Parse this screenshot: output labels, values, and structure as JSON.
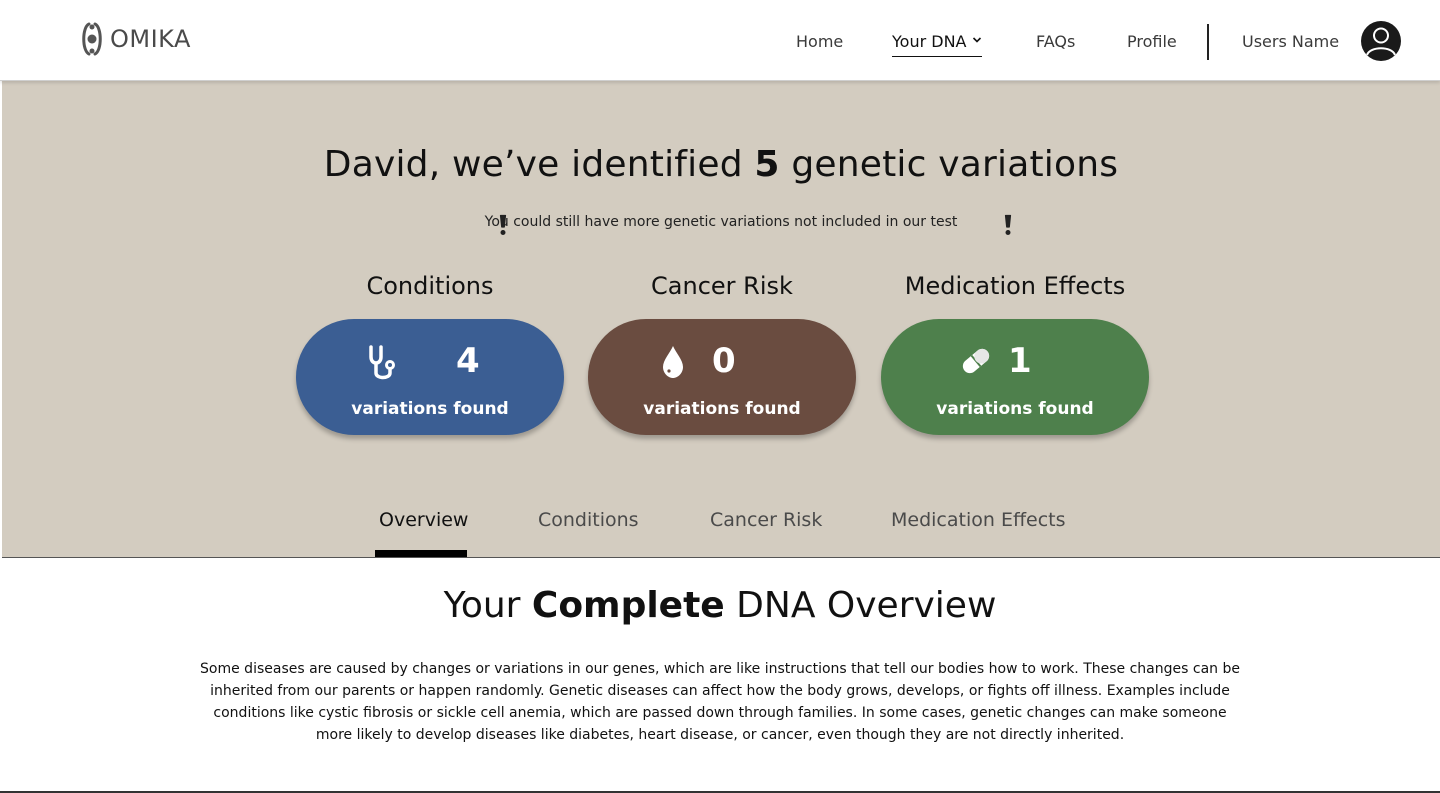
{
  "brand": {
    "name": "OMIKA"
  },
  "nav": {
    "home": "Home",
    "your_dna": "Your DNA",
    "faqs": "FAQs",
    "profile": "Profile",
    "user_name": "Users Name"
  },
  "hero": {
    "headline_prefix": "David, we’ve identified ",
    "headline_count": "5",
    "headline_suffix": " genetic variations",
    "notice": "You could still have more genetic variations not included in our test",
    "cards": [
      {
        "title": "Conditions",
        "count": "4",
        "label": "variations found",
        "icon": "stethoscope-icon",
        "color": "#3b5e93"
      },
      {
        "title": "Cancer Risk",
        "count": "0",
        "label": "variations found",
        "icon": "drop-icon",
        "color": "#6a4c40"
      },
      {
        "title": "Medication Effects",
        "count": "1",
        "label": "variations found",
        "icon": "pill-icon",
        "color": "#4e804c"
      }
    ]
  },
  "tabs": {
    "overview": "Overview",
    "conditions": "Conditions",
    "cancer_risk": "Cancer Risk",
    "medication_effects": "Medication Effects",
    "active": "Overview"
  },
  "overview": {
    "title_prefix": "Your ",
    "title_bold": "Complete",
    "title_suffix": " DNA Overview",
    "body": "Some diseases are caused by changes or variations in our genes, which are like instructions that tell our bodies how to work. These changes can be inherited from our parents or happen randomly. Genetic diseases can affect how the body grows, develops, or fights off illness. Examples include conditions like cystic fibrosis or sickle cell anemia, which are passed down through families. In some cases, genetic changes can make someone more likely to develop diseases like diabetes, heart disease, or cancer, even though they are not directly inherited."
  },
  "colors": {
    "hero_bg": "#d3ccc0",
    "conditions": "#3b5e93",
    "cancer": "#6a4c40",
    "medication": "#4e804c"
  }
}
